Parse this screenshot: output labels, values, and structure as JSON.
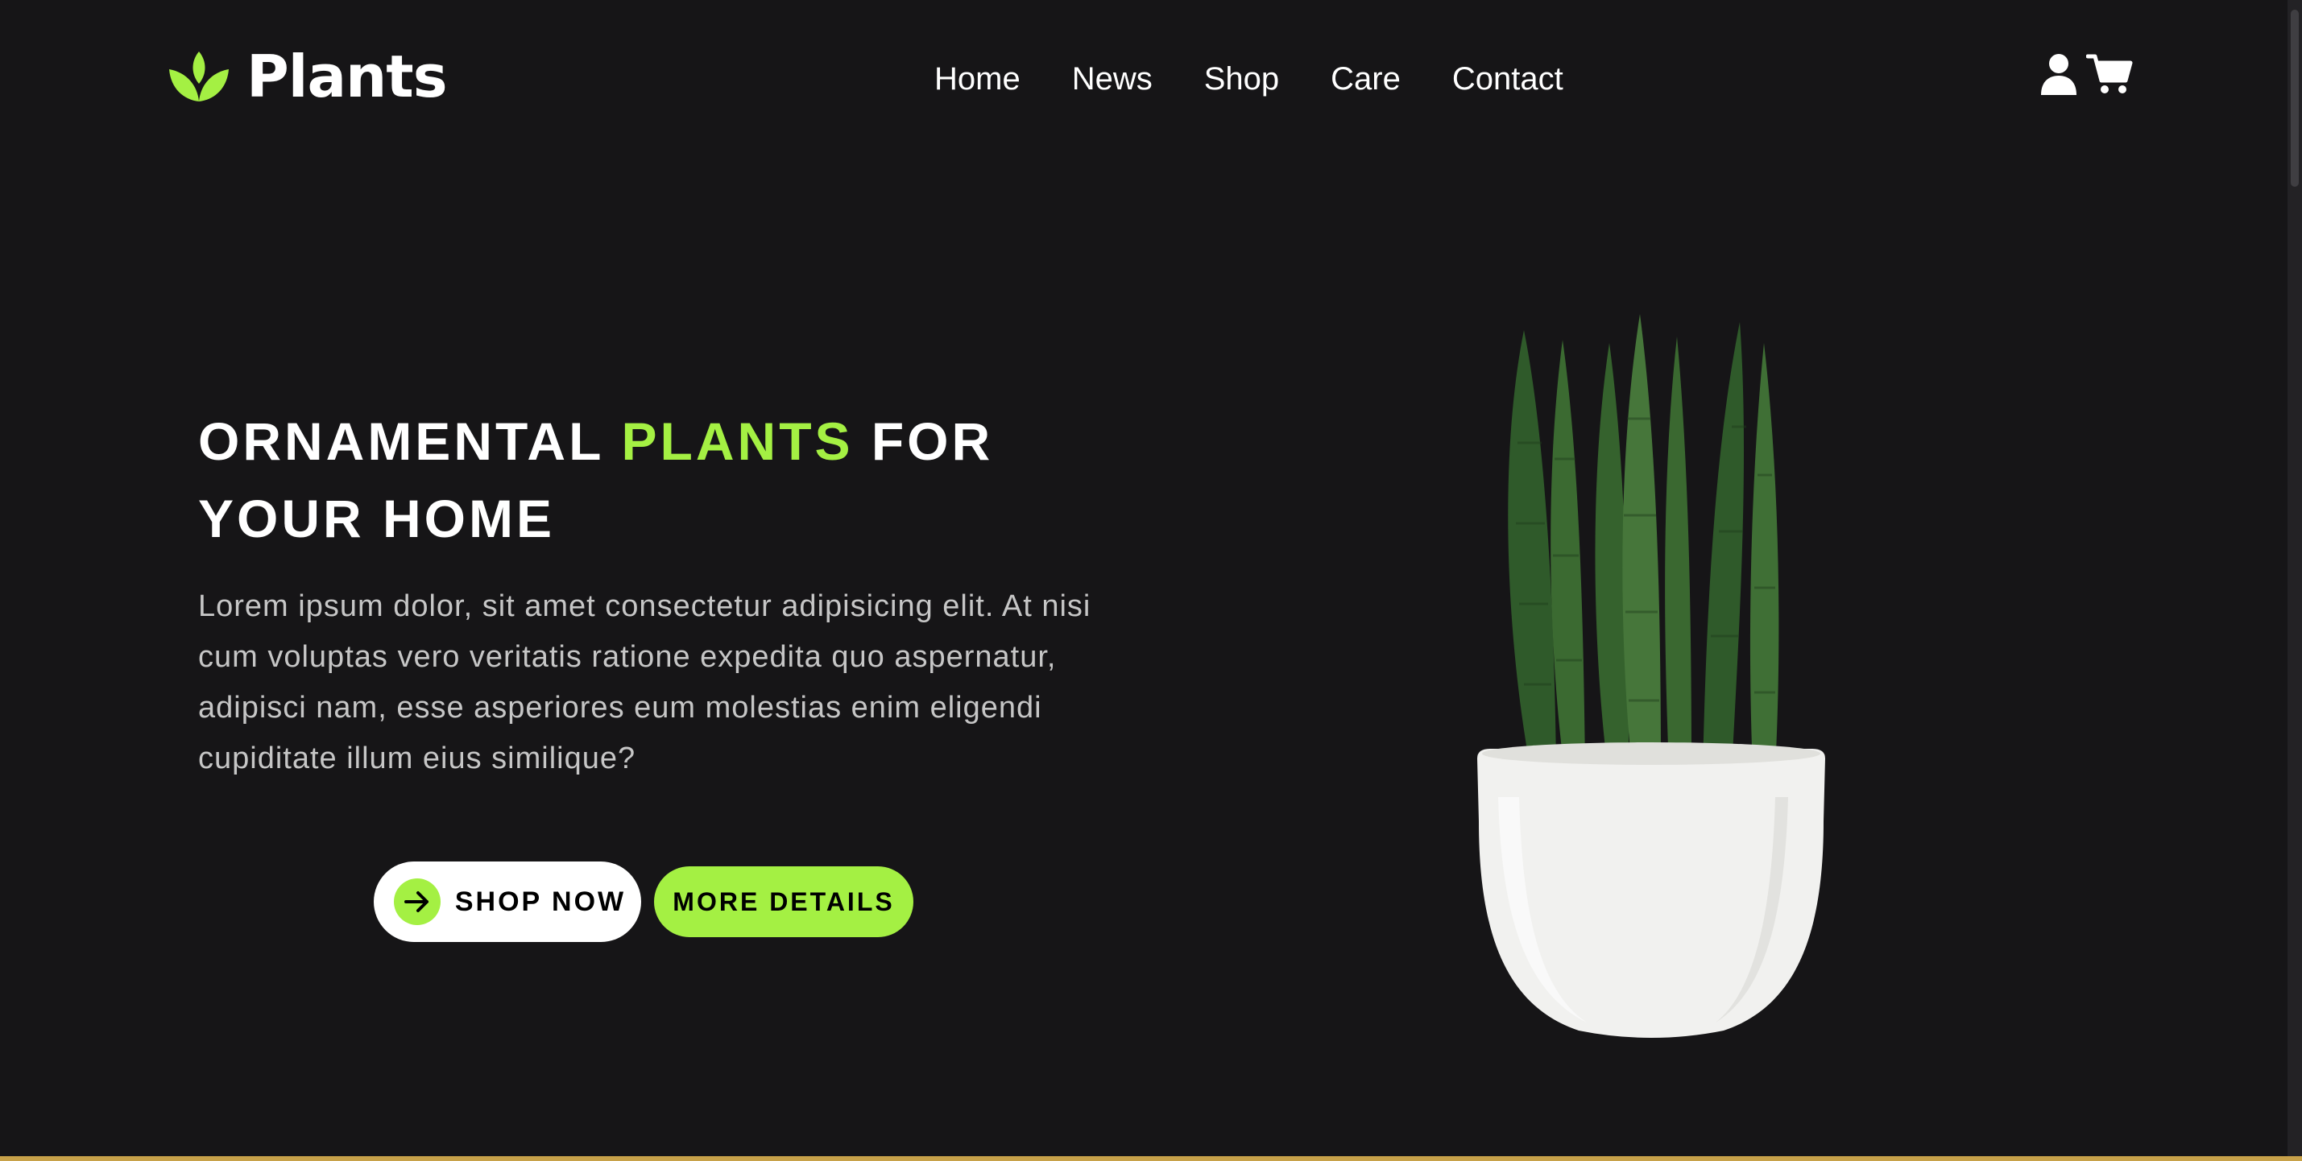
{
  "header": {
    "brand": "Plants",
    "nav": [
      {
        "label": "Home"
      },
      {
        "label": "News"
      },
      {
        "label": "Shop"
      },
      {
        "label": "Care"
      },
      {
        "label": "Contact"
      }
    ],
    "icons": [
      "user-icon",
      "cart-icon"
    ]
  },
  "hero": {
    "title_part1": "Ornamental ",
    "title_accent": "Plants",
    "title_part2": " for your home",
    "description": "Lorem ipsum dolor, sit amet consectetur adipisicing elit. At nisi cum voluptas vero veritatis ratione expedita quo aspernatur, adipisci nam, esse asperiores eum molestias enim eligendi cupiditate illum eius similique?",
    "primary_button": "Shop Now",
    "secondary_button": "More Details",
    "image": "potted-snake-plant"
  },
  "colors": {
    "background": "#161517",
    "accent": "#a4f043",
    "text": "#ffffff",
    "muted_text": "#c6c6c6"
  }
}
